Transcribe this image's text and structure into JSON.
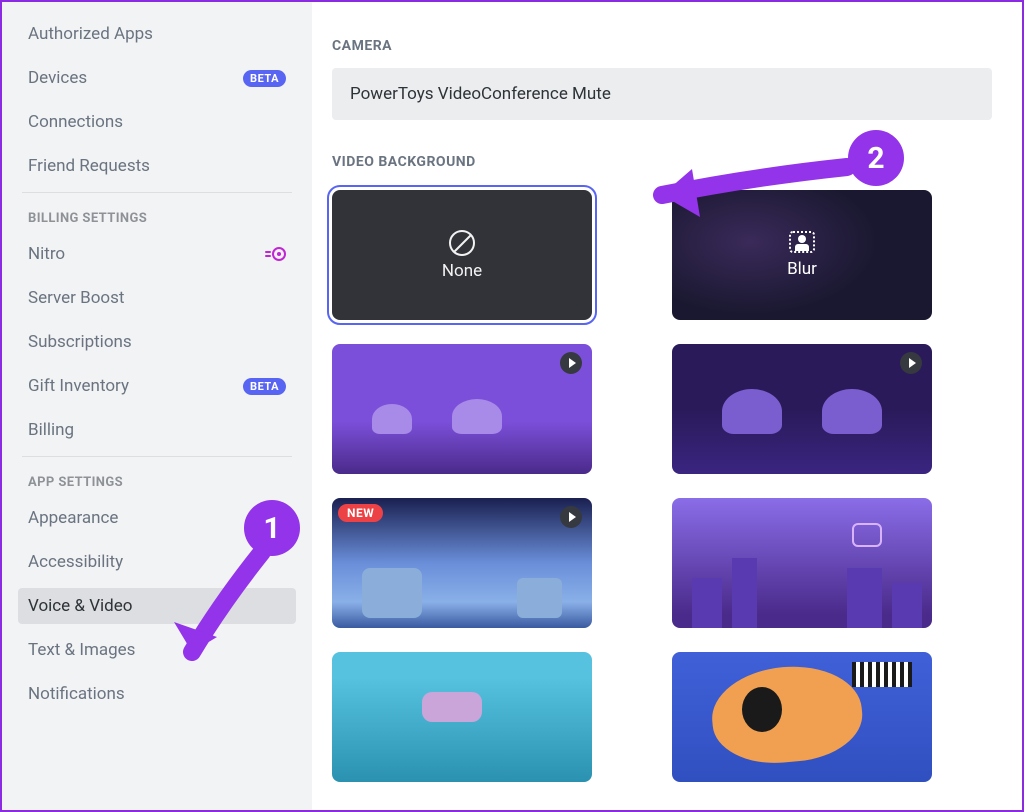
{
  "sidebar": {
    "items_top": [
      {
        "label": "Authorized Apps"
      },
      {
        "label": "Devices",
        "beta": "BETA"
      },
      {
        "label": "Connections"
      },
      {
        "label": "Friend Requests"
      }
    ],
    "billing_header": "BILLING SETTINGS",
    "billing_items": [
      {
        "label": "Nitro",
        "nitro": true
      },
      {
        "label": "Server Boost"
      },
      {
        "label": "Subscriptions"
      },
      {
        "label": "Gift Inventory",
        "beta": "BETA"
      },
      {
        "label": "Billing"
      }
    ],
    "app_header": "APP SETTINGS",
    "app_items": [
      {
        "label": "Appearance"
      },
      {
        "label": "Accessibility"
      },
      {
        "label": "Voice & Video",
        "active": true
      },
      {
        "label": "Text & Images"
      },
      {
        "label": "Notifications"
      }
    ]
  },
  "main": {
    "camera_header": "CAMERA",
    "camera_device": "PowerToys VideoConference Mute",
    "bg_header": "VIDEO BACKGROUND",
    "none_label": "None",
    "blur_label": "Blur",
    "new_label": "NEW"
  },
  "annotations": {
    "one": "1",
    "two": "2"
  }
}
